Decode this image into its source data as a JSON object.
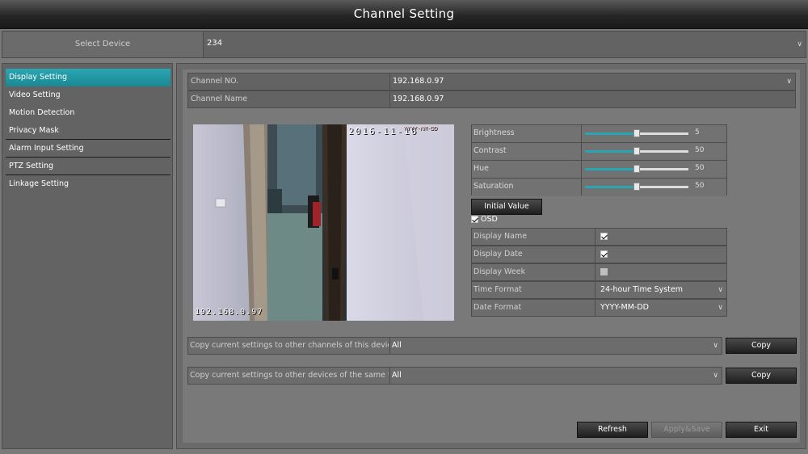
{
  "window": {
    "title": "Channel Setting"
  },
  "device": {
    "label": "Select Device",
    "value": "234"
  },
  "sidebar": {
    "items": [
      {
        "label": "Display Setting"
      },
      {
        "label": "Video Setting"
      },
      {
        "label": "Motion Detection"
      },
      {
        "label": "Privacy Mask"
      },
      {
        "label": "Alarm Input Setting"
      },
      {
        "label": "PTZ Setting"
      },
      {
        "label": "Linkage Setting"
      }
    ],
    "active_index": 0
  },
  "channel": {
    "no_label": "Channel NO.",
    "no_value": "192.168.0.97",
    "name_label": "Channel Name",
    "name_value": "192.168.0.97"
  },
  "preview": {
    "osd_datetime": "2016-11-16",
    "osd_date_format": "YYYY-MM-DD",
    "osd_name": "192.168.0.97"
  },
  "adjust": {
    "brightness": {
      "label": "Brightness",
      "value": 5,
      "percent": 0.5
    },
    "contrast": {
      "label": "Contrast",
      "value": 50,
      "percent": 0.5
    },
    "hue": {
      "label": "Hue",
      "value": 50,
      "percent": 0.5
    },
    "saturation": {
      "label": "Saturation",
      "value": 50,
      "percent": 0.5
    },
    "initial_button": "Initial Value"
  },
  "osd": {
    "label": "OSD",
    "checked": true,
    "display_name_label": "Display Name",
    "display_name_checked": true,
    "display_date_label": "Display Date",
    "display_date_checked": true,
    "display_week_label": "Display Week",
    "display_week_checked": false,
    "time_format_label": "Time Format",
    "time_format_value": "24-hour Time System",
    "date_format_label": "Date Format",
    "date_format_value": "YYYY-MM-DD"
  },
  "copy": {
    "channels_label": "Copy current settings to other channels of this device",
    "channels_value": "All",
    "devices_label": "Copy current settings to other devices of the same t...",
    "devices_value": "All",
    "button": "Copy"
  },
  "footer": {
    "refresh": "Refresh",
    "apply": "Apply&Save",
    "exit": "Exit"
  }
}
